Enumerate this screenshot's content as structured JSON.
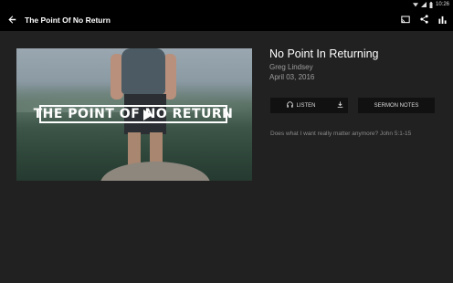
{
  "status_bar": {
    "time": "10:26",
    "icons": [
      "wifi-icon",
      "signal-icon",
      "battery-icon"
    ]
  },
  "app_bar": {
    "title": "The Point Of No Return",
    "icons": [
      "back-arrow-icon",
      "cast-icon",
      "share-icon",
      "bar-chart-icon"
    ]
  },
  "video": {
    "overlay_title": "THE POINT OF NO RETURN"
  },
  "sermon": {
    "title": "No Point In Returning",
    "speaker": "Greg Lindsey",
    "date": "April 03, 2016",
    "description": "Does what I want really matter anymore? John 5:1-15"
  },
  "buttons": {
    "listen_label": "LISTEN",
    "notes_label": "SERMON NOTES",
    "icons": [
      "headphones-icon",
      "download-icon"
    ]
  }
}
